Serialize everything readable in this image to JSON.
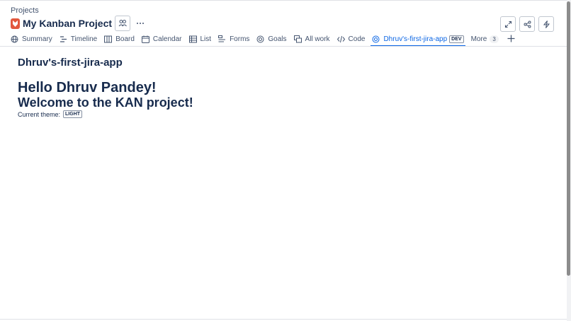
{
  "breadcrumb": "Projects",
  "project": {
    "title": "My Kanban Project",
    "icon": "project-avatar-icon",
    "accent": "#e2583e"
  },
  "header_actions": [
    "expand-icon",
    "share-icon",
    "lightning-icon"
  ],
  "tabs": [
    {
      "label": "Summary",
      "icon": "globe-icon"
    },
    {
      "label": "Timeline",
      "icon": "timeline-icon"
    },
    {
      "label": "Board",
      "icon": "board-icon"
    },
    {
      "label": "Calendar",
      "icon": "calendar-icon"
    },
    {
      "label": "List",
      "icon": "list-icon"
    },
    {
      "label": "Forms",
      "icon": "forms-icon"
    },
    {
      "label": "Goals",
      "icon": "goals-icon"
    },
    {
      "label": "All work",
      "icon": "all-work-icon"
    },
    {
      "label": "Code",
      "icon": "code-icon"
    },
    {
      "label": "Dhruv's-first-jira-app",
      "icon": "app-icon",
      "badge": "DEV",
      "active": true
    },
    {
      "label": "More",
      "count": "3"
    }
  ],
  "active_color": "#0c66e4",
  "content": {
    "app_title": "Dhruv's-first-jira-app",
    "greeting": "Hello Dhruv Pandey!",
    "welcome": "Welcome to the KAN project!",
    "theme_label": "Current theme:",
    "theme_value": "LIGHT"
  }
}
